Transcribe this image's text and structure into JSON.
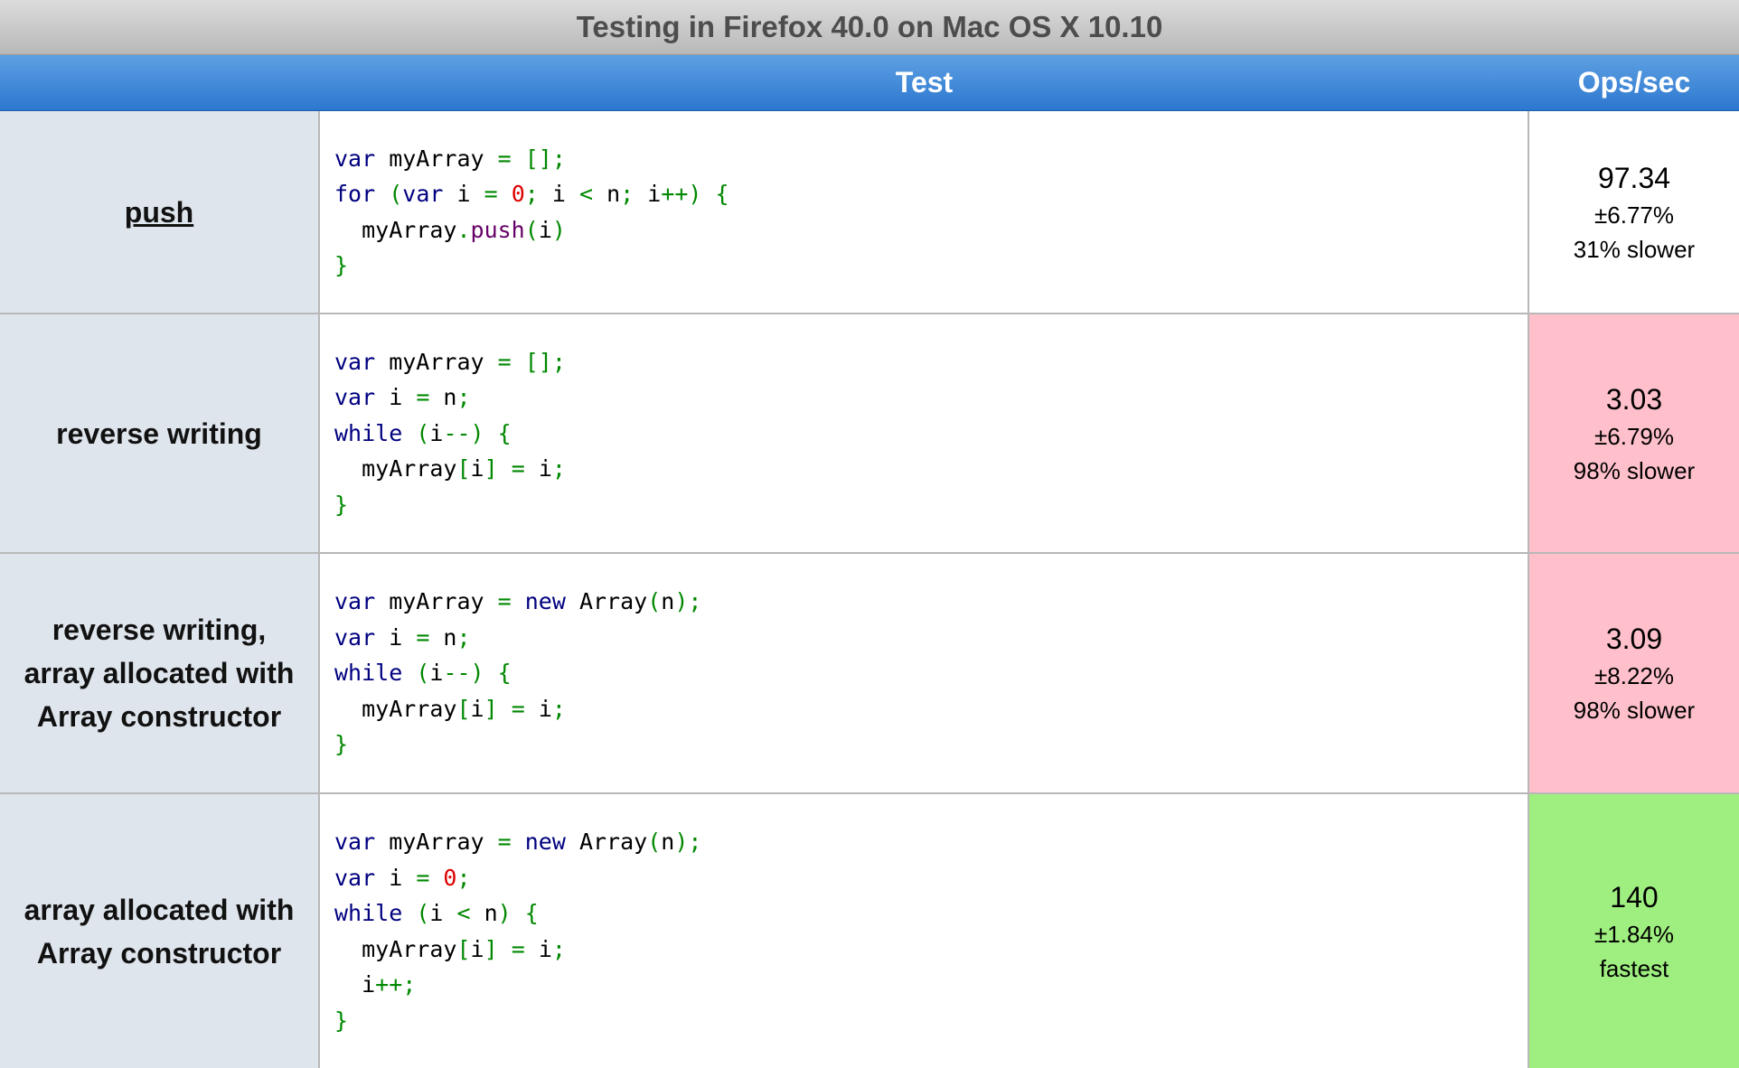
{
  "title": "Testing in Firefox 40.0 on Mac OS X 10.10",
  "header": {
    "test": "Test",
    "ops": "Ops/sec"
  },
  "colors": {
    "slower": "#ffc0cb",
    "fastest": "#9fee80",
    "header_blue": "#2d77d0"
  },
  "rows": [
    {
      "title": "push",
      "code": {
        "l1_kw": "var",
        "l1_a": " myArray ",
        "l1_op": "= [];",
        "l2_kw1": "for",
        "l2_p1": " (",
        "l2_kw2": "var",
        "l2_a": " i ",
        "l2_op1": "= ",
        "l2_num": "0",
        "l2_p2": "; ",
        "l2_b": "i ",
        "l2_op2": "< ",
        "l2_c": "n",
        "l2_p3": "; ",
        "l2_d": "i",
        "l2_op3": "++) {",
        "l3_a": "  myArray",
        "l3_p1": ".",
        "l3_meth": "push",
        "l3_p2": "(",
        "l3_b": "i",
        "l3_p3": ")",
        "l4": "}"
      },
      "ops": "97.34",
      "error": "±6.77%",
      "relative": "31% slower"
    },
    {
      "title": "reverse writing",
      "code": {
        "l1_kw": "var",
        "l1_a": " myArray ",
        "l1_op": "= [];",
        "l2_kw": "var",
        "l2_a": " i ",
        "l2_op": "= ",
        "l2_b": "n",
        "l2_p": ";",
        "l3_kw": "while",
        "l3_p1": " (",
        "l3_a": "i",
        "l3_p2": "--) {",
        "l4_a": "  myArray",
        "l4_p1": "[",
        "l4_b": "i",
        "l4_p2": "] = ",
        "l4_c": "i",
        "l4_p3": ";",
        "l5": "}"
      },
      "ops": "3.03",
      "error": "±6.79%",
      "relative": "98% slower"
    },
    {
      "title_l1": "reverse writing,",
      "title_l2": "array allocated with",
      "title_l3": "Array constructor",
      "code": {
        "l1_kw": "var",
        "l1_a": " myArray ",
        "l1_op": "= ",
        "l1_kw2": "new",
        "l1_b": " Array",
        "l1_p1": "(",
        "l1_c": "n",
        "l1_p2": ");",
        "l2_kw": "var",
        "l2_a": " i ",
        "l2_op": "= ",
        "l2_b": "n",
        "l2_p": ";",
        "l3_kw": "while",
        "l3_p1": " (",
        "l3_a": "i",
        "l3_p2": "--) {",
        "l4_a": "  myArray",
        "l4_p1": "[",
        "l4_b": "i",
        "l4_p2": "] = ",
        "l4_c": "i",
        "l4_p3": ";",
        "l5": "}"
      },
      "ops": "3.09",
      "error": "±8.22%",
      "relative": "98% slower"
    },
    {
      "title_l1": "array allocated with",
      "title_l2": "Array constructor",
      "code": {
        "l1_kw": "var",
        "l1_a": " myArray ",
        "l1_op": "= ",
        "l1_kw2": "new",
        "l1_b": " Array",
        "l1_p1": "(",
        "l1_c": "n",
        "l1_p2": ");",
        "l2_kw": "var",
        "l2_a": " i ",
        "l2_op": "= ",
        "l2_num": "0",
        "l2_p": ";",
        "l3_kw": "while",
        "l3_p1": " (",
        "l3_a": "i ",
        "l3_op": "< ",
        "l3_b": "n",
        "l3_p2": ") {",
        "l4_a": "  myArray",
        "l4_p1": "[",
        "l4_b": "i",
        "l4_p2": "] = ",
        "l4_c": "i",
        "l4_p3": ";",
        "l5_a": "  i",
        "l5_p": "++;",
        "l6": "}"
      },
      "ops": "140",
      "error": "±1.84%",
      "relative": "fastest"
    }
  ]
}
